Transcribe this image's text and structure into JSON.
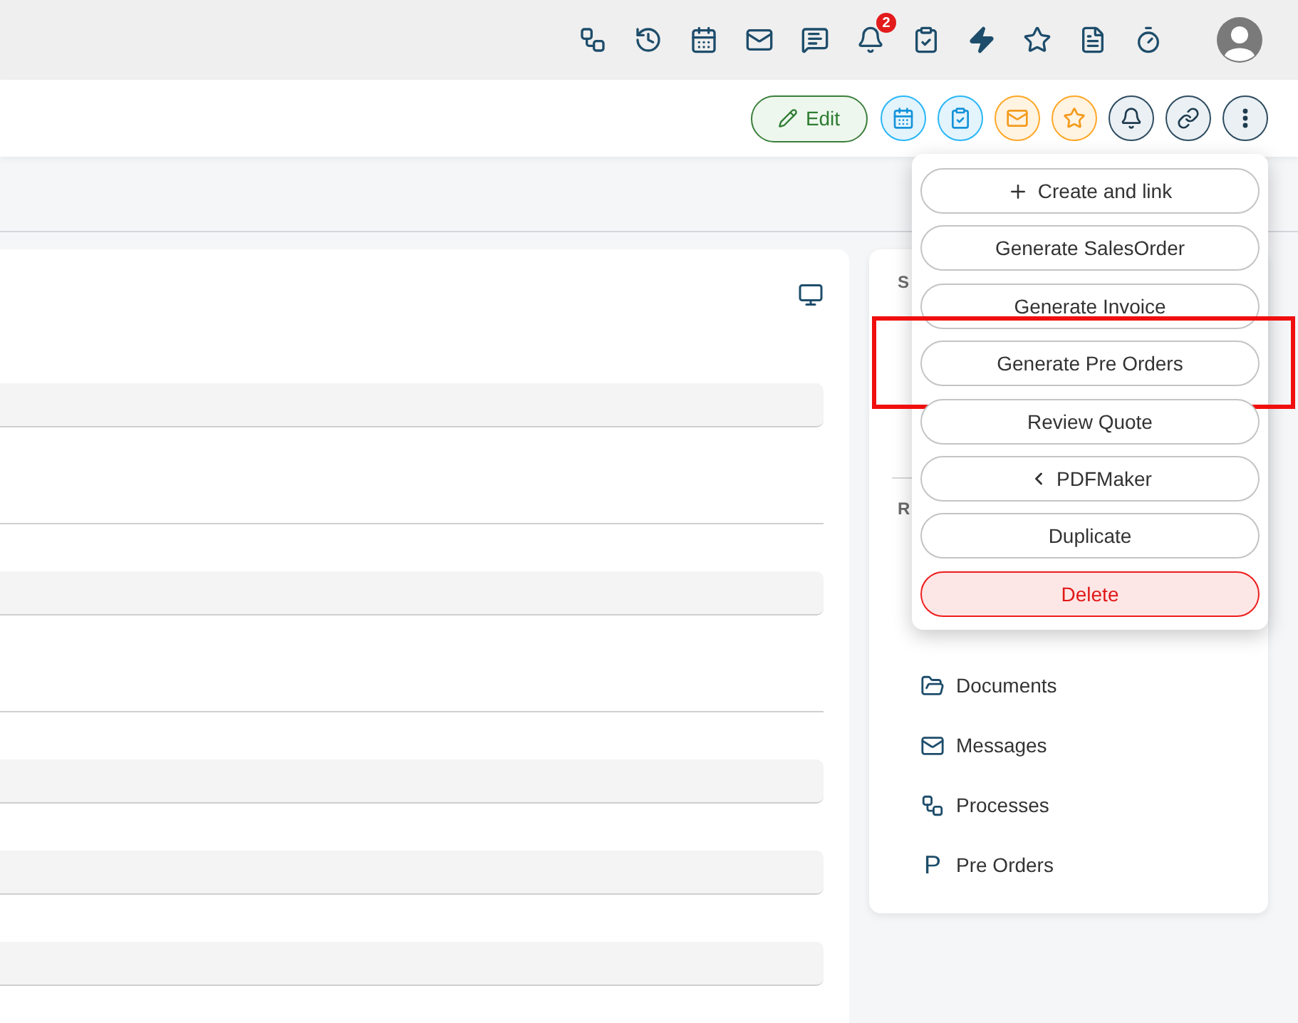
{
  "top_bar": {
    "icons": [
      {
        "kind": "processes"
      },
      {
        "kind": "history"
      },
      {
        "kind": "calendar"
      },
      {
        "kind": "mail"
      },
      {
        "kind": "chat"
      },
      {
        "kind": "bell",
        "badge": "2"
      },
      {
        "kind": "task"
      },
      {
        "kind": "bolt"
      },
      {
        "kind": "star"
      },
      {
        "kind": "document"
      },
      {
        "kind": "timer"
      }
    ]
  },
  "toolbar": {
    "edit_button": "Edit",
    "actions": [
      {
        "kind": "calendar"
      },
      {
        "kind": "task"
      },
      {
        "kind": "mail"
      },
      {
        "kind": "star"
      },
      {
        "kind": "bell"
      },
      {
        "kind": "link"
      },
      {
        "kind": "more"
      }
    ]
  },
  "main_card": {
    "fields": [
      {
        "kind": "filled"
      },
      {
        "kind": "line"
      },
      {
        "kind": "filled"
      },
      {
        "kind": "line"
      },
      {
        "kind": "filled"
      },
      {
        "kind": "filled"
      },
      {
        "kind": "filled"
      }
    ]
  },
  "side_card": {
    "section_1": "S",
    "section_2": "R",
    "related": [
      {
        "kind": "documents",
        "label": "Documents"
      },
      {
        "kind": "messages",
        "label": "Messages"
      },
      {
        "kind": "processes",
        "label": "Processes"
      },
      {
        "kind": "letter",
        "icon_text": "P",
        "label": "Pre Orders"
      }
    ]
  },
  "menu": {
    "items": [
      {
        "kind": "create",
        "label": "Create and link",
        "highlighted": false
      },
      {
        "kind": "action",
        "label": "Generate SalesOrder",
        "highlighted": false
      },
      {
        "kind": "action",
        "label": "Generate Invoice",
        "highlighted": false
      },
      {
        "kind": "action",
        "label": "Generate Pre Orders",
        "highlighted": true
      },
      {
        "kind": "action",
        "label": "Review Quote",
        "highlighted": false
      },
      {
        "kind": "submenu",
        "label": "PDFMaker",
        "highlighted": false
      },
      {
        "kind": "action",
        "label": "Duplicate",
        "highlighted": false
      },
      {
        "kind": "danger",
        "label": "Delete",
        "highlighted": false
      }
    ]
  }
}
